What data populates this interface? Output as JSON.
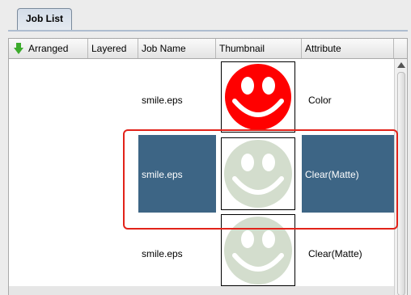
{
  "tab": {
    "label": "Job List"
  },
  "columns": [
    {
      "label": "Arranged"
    },
    {
      "label": "Layered"
    },
    {
      "label": "Job Name"
    },
    {
      "label": "Thumbnail"
    },
    {
      "label": "Attribute"
    }
  ],
  "rows": [
    {
      "job_name": "smile.eps",
      "attribute": "Color",
      "selected": false,
      "thumbnail_color": "#ff0000"
    },
    {
      "job_name": "smile.eps",
      "attribute": "Clear(Matte)",
      "selected": true,
      "thumbnail_color": "#d3ddcd"
    },
    {
      "job_name": "smile.eps",
      "attribute": "Clear(Matte)",
      "selected": false,
      "thumbnail_color": "#d3ddcd"
    }
  ],
  "colors": {
    "selection": "#3d6585",
    "highlight_border": "#e2231a",
    "sort_arrow": "#3cab2c"
  },
  "icons": {
    "sort": "down-arrow-icon",
    "scroll_up": "triangle-up-icon"
  }
}
